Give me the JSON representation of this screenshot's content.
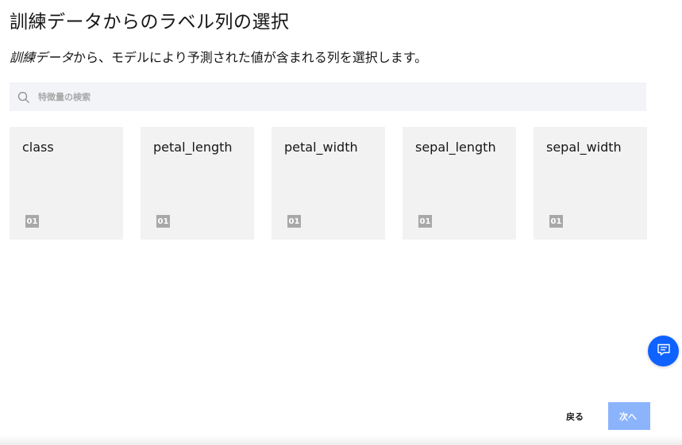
{
  "page": {
    "title": "訓練データからのラベル列の選択",
    "description_em": "訓練データ",
    "description_rest": "から、モデルにより予測された値が含まれる列を選択します。"
  },
  "search": {
    "placeholder": "特徴量の検索",
    "icon": "search-icon"
  },
  "columns": [
    {
      "label": "class",
      "type_badge": "01"
    },
    {
      "label": "petal_length",
      "type_badge": "01"
    },
    {
      "label": "petal_width",
      "type_badge": "01"
    },
    {
      "label": "sepal_length",
      "type_badge": "01"
    },
    {
      "label": "sepal_width",
      "type_badge": "01"
    }
  ],
  "chat": {
    "icon": "chat-icon",
    "color": "#0f62fe"
  },
  "footer": {
    "back_label": "戻る",
    "next_label": "次へ",
    "next_color": "#8cb4fd"
  }
}
